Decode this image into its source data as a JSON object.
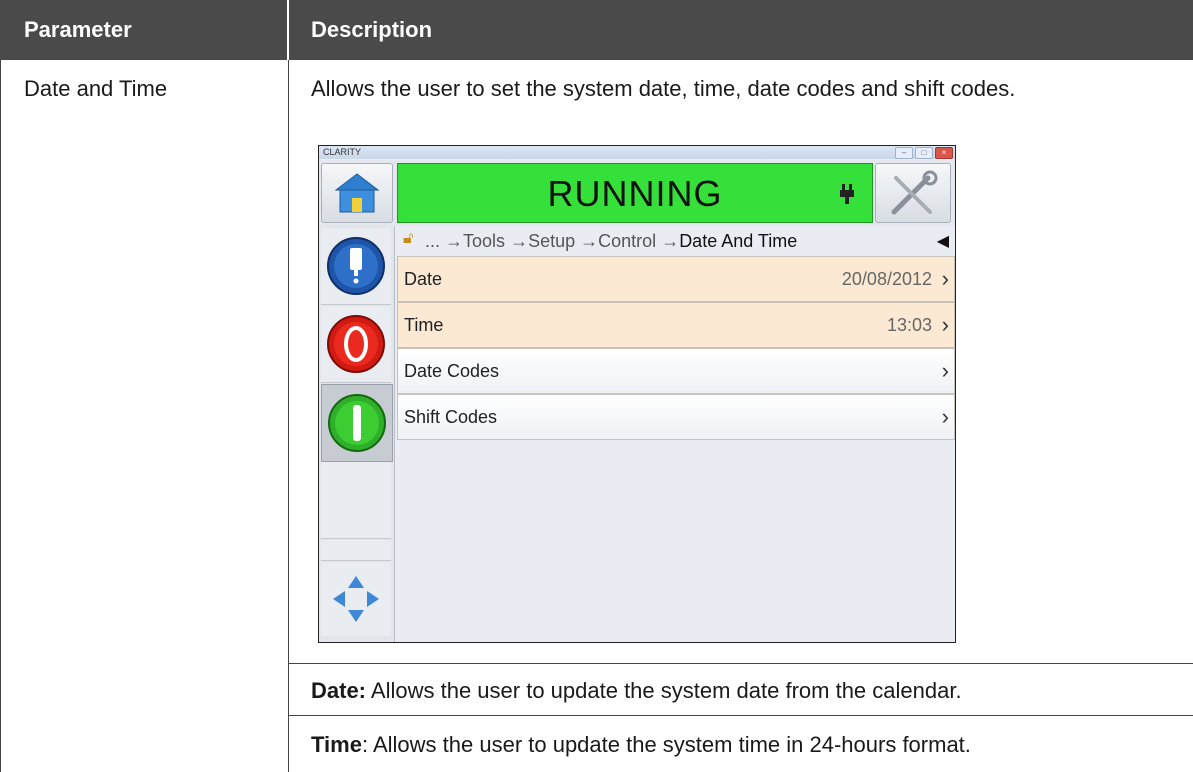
{
  "table": {
    "headers": [
      "Parameter",
      "Description"
    ],
    "parameter": "Date and Time",
    "description": "Allows the user to set the system date, time, date codes and shift codes.",
    "notes": [
      {
        "term": "Date:",
        "text": " Allows the user to update the system date from the calendar."
      },
      {
        "term": "Time",
        "text": ": Allows the user to update the system time in 24-hours format."
      }
    ]
  },
  "screenshot": {
    "app_title": "CLARITY",
    "status": "RUNNING",
    "status_color": "#35e03a",
    "breadcrumb": {
      "ellipsis": "...",
      "items": [
        "Tools",
        "Setup",
        "Control"
      ],
      "current": "Date And Time"
    },
    "rows": [
      {
        "label": "Date",
        "value": "20/08/2012"
      },
      {
        "label": "Time",
        "value": "13:03"
      },
      {
        "label": "Date Codes",
        "value": ""
      },
      {
        "label": "Shift Codes",
        "value": ""
      }
    ],
    "icons": {
      "home": "home-icon",
      "tools": "tools-icon",
      "plug": "plug-icon",
      "lock": "lock-icon",
      "back": "back-arrow-icon",
      "printhead": "printhead-icon",
      "stop": "stop-icon",
      "start": "start-icon",
      "navigate": "navigate-arrows-icon"
    }
  }
}
